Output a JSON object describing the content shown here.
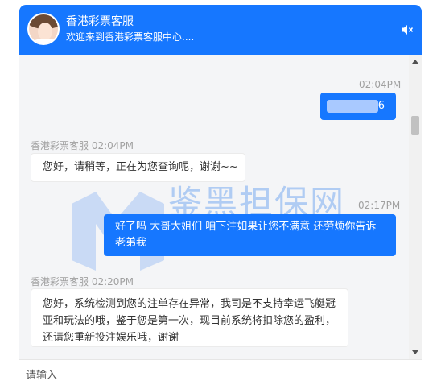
{
  "header": {
    "title": "香港彩票客服",
    "subtitle": "欢迎来到香港彩票客服中心....",
    "mute_icon": "speaker-mute-icon",
    "brand_color": "#1677ff"
  },
  "messages": [
    {
      "direction": "out",
      "time": "02:04PM",
      "text": "6"
    },
    {
      "direction": "in",
      "sender": "香港彩票客服",
      "time": "02:04PM",
      "text": "您好，请稍等，正在为您查询呢，谢谢~~"
    },
    {
      "direction": "out",
      "time": "02:17PM",
      "text": "好了吗 大哥大姐们 咱下注如果让您不满意 还劳烦你告诉老弟我"
    },
    {
      "direction": "in",
      "sender": "香港彩票客服",
      "time": "02:20PM",
      "text": "您好，系统检测到您的注单存在异常，我司是不支持幸运飞艇冠亚和玩法的哦，鉴于您是第一次，现目前系统将扣除您的盈利，还请您重新投注娱乐哦，谢谢"
    }
  ],
  "watermark": {
    "text": "鉴黑担保网",
    "url": "www.jhdb8.com"
  },
  "input": {
    "placeholder": "请输入"
  }
}
